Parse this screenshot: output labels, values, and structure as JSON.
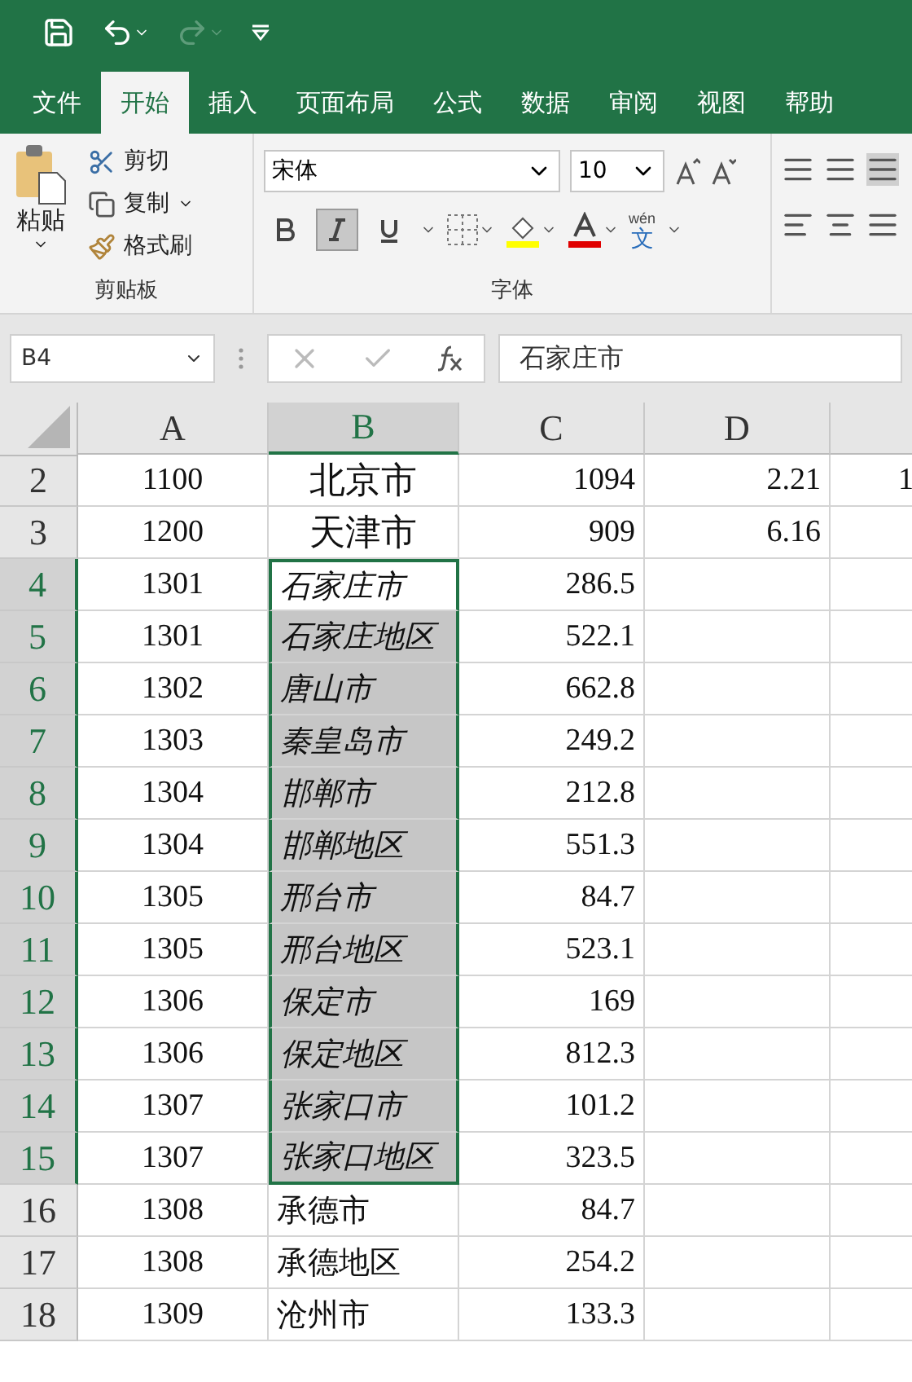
{
  "quick_access": {
    "undo_enabled": true,
    "redo_enabled": false
  },
  "tabs": [
    {
      "label": "文件",
      "selected": false
    },
    {
      "label": "开始",
      "selected": true
    },
    {
      "label": "插入",
      "selected": false
    },
    {
      "label": "页面布局",
      "selected": false
    },
    {
      "label": "公式",
      "selected": false
    },
    {
      "label": "数据",
      "selected": false
    },
    {
      "label": "审阅",
      "selected": false
    },
    {
      "label": "视图",
      "selected": false
    },
    {
      "label": "帮助",
      "selected": false
    }
  ],
  "clipboard": {
    "paste": "粘贴",
    "cut": "剪切",
    "copy": "复制",
    "format_painter": "格式刷",
    "group_label": "剪贴板"
  },
  "font": {
    "name": "宋体",
    "size": "10",
    "bold": false,
    "italic": true,
    "underline": false,
    "phonetic": "wén",
    "phonetic_char": "文",
    "group_label": "字体"
  },
  "name_box": "B4",
  "formula": "石家庄市",
  "columns": [
    {
      "label": "A",
      "selected": false
    },
    {
      "label": "B",
      "selected": true
    },
    {
      "label": "C",
      "selected": false
    },
    {
      "label": "D",
      "selected": false
    }
  ],
  "rows": [
    {
      "header": "2",
      "a": "1100",
      "b": "北京市",
      "c": "1094",
      "d": "2.21",
      "e": "1",
      "kind": "large",
      "selected": false,
      "active": false
    },
    {
      "header": "3",
      "a": "1200",
      "b": "天津市",
      "c": "909",
      "d": "6.16",
      "kind": "large",
      "selected": false,
      "active": false
    },
    {
      "header": "4",
      "a": "1301",
      "b": "石家庄市",
      "c": "286.5",
      "kind": "italic",
      "selected": true,
      "active": true
    },
    {
      "header": "5",
      "a": "1301",
      "b": "石家庄地区",
      "c": "522.1",
      "kind": "italic",
      "selected": true,
      "active": false
    },
    {
      "header": "6",
      "a": "1302",
      "b": "唐山市",
      "c": "662.8",
      "kind": "italic",
      "selected": true,
      "active": false
    },
    {
      "header": "7",
      "a": "1303",
      "b": "秦皇岛市",
      "c": "249.2",
      "kind": "italic",
      "selected": true,
      "active": false
    },
    {
      "header": "8",
      "a": "1304",
      "b": "邯郸市",
      "c": "212.8",
      "kind": "italic",
      "selected": true,
      "active": false
    },
    {
      "header": "9",
      "a": "1304",
      "b": "邯郸地区",
      "c": "551.3",
      "kind": "italic",
      "selected": true,
      "active": false
    },
    {
      "header": "10",
      "a": "1305",
      "b": "邢台市",
      "c": "84.7",
      "kind": "italic",
      "selected": true,
      "active": false
    },
    {
      "header": "11",
      "a": "1305",
      "b": "邢台地区",
      "c": "523.1",
      "kind": "italic",
      "selected": true,
      "active": false
    },
    {
      "header": "12",
      "a": "1306",
      "b": "保定市",
      "c": "169",
      "kind": "italic",
      "selected": true,
      "active": false
    },
    {
      "header": "13",
      "a": "1306",
      "b": "保定地区",
      "c": "812.3",
      "kind": "italic",
      "selected": true,
      "active": false
    },
    {
      "header": "14",
      "a": "1307",
      "b": "张家口市",
      "c": "101.2",
      "kind": "italic",
      "selected": true,
      "active": false
    },
    {
      "header": "15",
      "a": "1307",
      "b": "张家口地区",
      "c": "323.5",
      "kind": "italic",
      "selected": true,
      "active": false
    },
    {
      "header": "16",
      "a": "1308",
      "b": "承德市",
      "c": "84.7",
      "kind": "normal",
      "selected": false,
      "active": false
    },
    {
      "header": "17",
      "a": "1308",
      "b": "承德地区",
      "c": "254.2",
      "kind": "normal",
      "selected": false,
      "active": false
    },
    {
      "header": "18",
      "a": "1309",
      "b": "沧州市",
      "c": "133.3",
      "kind": "normal",
      "selected": false,
      "active": false
    }
  ]
}
